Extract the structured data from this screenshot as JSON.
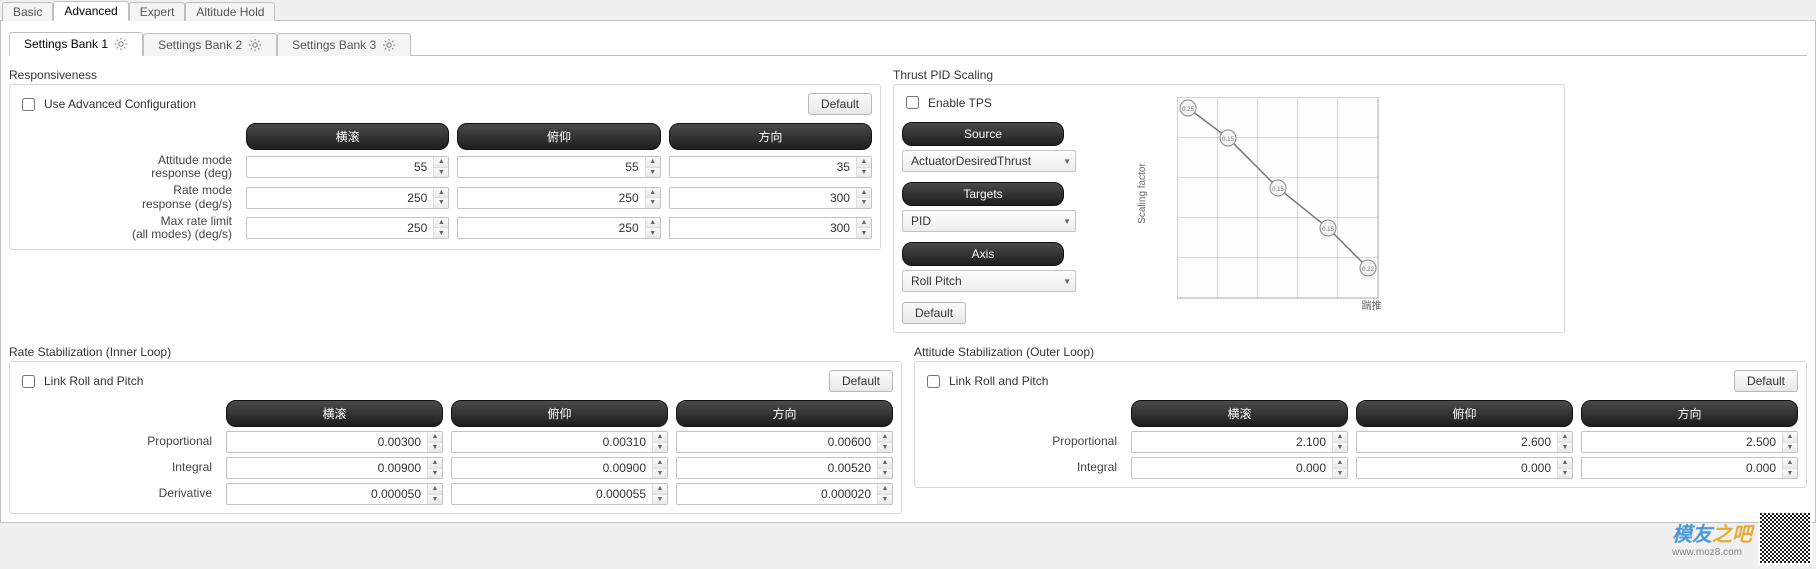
{
  "top_tabs": {
    "basic": "Basic",
    "advanced": "Advanced",
    "expert": "Expert",
    "altitude_hold": "Altitude Hold"
  },
  "bank_tabs": {
    "b1": "Settings Bank 1",
    "b2": "Settings Bank 2",
    "b3": "Settings Bank 3"
  },
  "responsiveness": {
    "title": "Responsiveness",
    "use_adv_label": "Use Advanced Configuration",
    "default_btn": "Default",
    "col_roll": "横滚",
    "col_pitch": "俯仰",
    "col_yaw": "方向",
    "rows": {
      "attitude": {
        "label": "Attitude mode\nresponse (deg)",
        "roll": "55",
        "pitch": "55",
        "yaw": "35"
      },
      "rate": {
        "label": "Rate mode\nresponse (deg/s)",
        "roll": "250",
        "pitch": "250",
        "yaw": "300"
      },
      "maxrate": {
        "label": "Max rate limit\n(all modes) (deg/s)",
        "roll": "250",
        "pitch": "250",
        "yaw": "300"
      }
    }
  },
  "tps": {
    "title": "Thrust PID Scaling",
    "enable_label": "Enable TPS",
    "source_label": "Source",
    "source_value": "ActuatorDesiredThrust",
    "targets_label": "Targets",
    "targets_value": "PID",
    "axis_label": "Axis",
    "axis_value": "Roll Pitch",
    "default_btn": "Default",
    "chart_ylabel": "Scaling factor",
    "chart_xlabel": "踹推"
  },
  "inner_loop": {
    "title": "Rate Stabilization (Inner Loop)",
    "link_label": "Link Roll and Pitch",
    "default_btn": "Default",
    "col_roll": "横滚",
    "col_pitch": "俯仰",
    "col_yaw": "方向",
    "rows": {
      "p": {
        "label": "Proportional",
        "roll": "0.00300",
        "pitch": "0.00310",
        "yaw": "0.00600"
      },
      "i": {
        "label": "Integral",
        "roll": "0.00900",
        "pitch": "0.00900",
        "yaw": "0.00520"
      },
      "d": {
        "label": "Derivative",
        "roll": "0.000050",
        "pitch": "0.000055",
        "yaw": "0.000020"
      }
    }
  },
  "outer_loop": {
    "title": "Attitude Stabilization (Outer Loop)",
    "link_label": "Link Roll and Pitch",
    "default_btn": "Default",
    "col_roll": "横滚",
    "col_pitch": "俯仰",
    "col_yaw": "方向",
    "rows": {
      "p": {
        "label": "Proportional",
        "roll": "2.100",
        "pitch": "2.600",
        "yaw": "2.500"
      },
      "i": {
        "label": "Integral",
        "roll": "0.000",
        "pitch": "0.000",
        "yaw": "0.000"
      }
    }
  },
  "watermark": {
    "brand_main": "模友",
    "brand_suffix": "之吧",
    "url": "www.moz8.com"
  },
  "chart_data": {
    "type": "line",
    "title": "",
    "xlabel": "踹推",
    "ylabel": "Scaling factor",
    "xlim": [
      0,
      1
    ],
    "ylim": [
      0,
      1
    ],
    "x": [
      0.05,
      0.25,
      0.5,
      0.75,
      0.95
    ],
    "y": [
      0.95,
      0.8,
      0.55,
      0.35,
      0.15
    ],
    "point_labels": [
      "0.25",
      "0.15",
      "0.15",
      "0.15",
      "0.22"
    ]
  }
}
